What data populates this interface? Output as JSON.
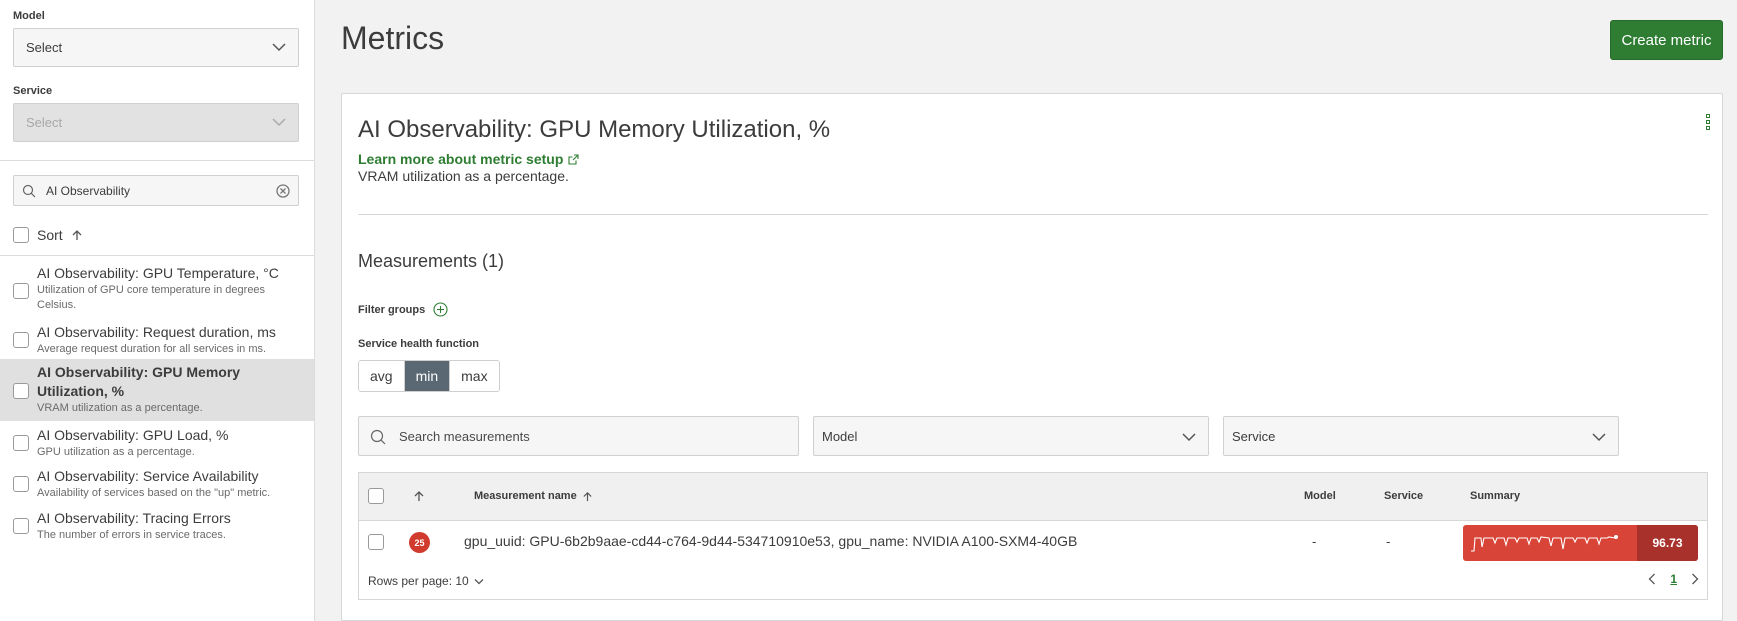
{
  "sidebar": {
    "model_label": "Model",
    "model_value": "Select",
    "service_label": "Service",
    "service_value": "Select",
    "search_value": "AI Observability",
    "sort_label": "Sort",
    "items": [
      {
        "title": "AI Observability: GPU Temperature, °C",
        "desc_1": "Utilization of GPU core temperature in degrees",
        "desc_2": "Celsius."
      },
      {
        "title": "AI Observability: Request duration, ms",
        "desc": "Average request duration for all services in ms."
      },
      {
        "title_1": "AI Observability: GPU Memory",
        "title_2": "Utilization, %",
        "desc": "VRAM utilization as a percentage.",
        "selected": true
      },
      {
        "title": "AI Observability: GPU Load, %",
        "desc": "GPU utilization as a percentage."
      },
      {
        "title": "AI Observability: Service Availability",
        "desc": "Availability of services based on the \"up\" metric."
      },
      {
        "title": "AI Observability: Tracing Errors",
        "desc": "The number of errors in service traces."
      }
    ]
  },
  "header": {
    "title": "Metrics",
    "create_label": "Create metric"
  },
  "metric": {
    "title": "AI Observability: GPU Memory Utilization, %",
    "learn_link": "Learn more about metric setup",
    "description": "VRAM utilization as a percentage."
  },
  "measurements": {
    "title": "Measurements (1)",
    "filter_groups_label": "Filter groups",
    "health_label": "Service health function",
    "health_options": [
      "avg",
      "min",
      "max"
    ],
    "health_selected": "min",
    "search_placeholder": "Search measurements",
    "model_filter": "Model",
    "service_filter": "Service",
    "columns": {
      "name": "Measurement name",
      "model": "Model",
      "service": "Service",
      "summary": "Summary"
    },
    "rows": [
      {
        "badge": "25",
        "name": "gpu_uuid: GPU-6b2b9aae-cd44-c764-9d44-534710910e53, gpu_name: NVIDIA A100-SXM4-40GB",
        "model": "-",
        "service": "-",
        "summary_value": "96.73"
      }
    ],
    "rows_per_page": "Rows per page: 10",
    "page": "1"
  },
  "colors": {
    "accent_green": "#2e7d32",
    "alert_red": "#d94438",
    "alert_dark": "#a8322b",
    "segment_active": "#5a6873"
  }
}
